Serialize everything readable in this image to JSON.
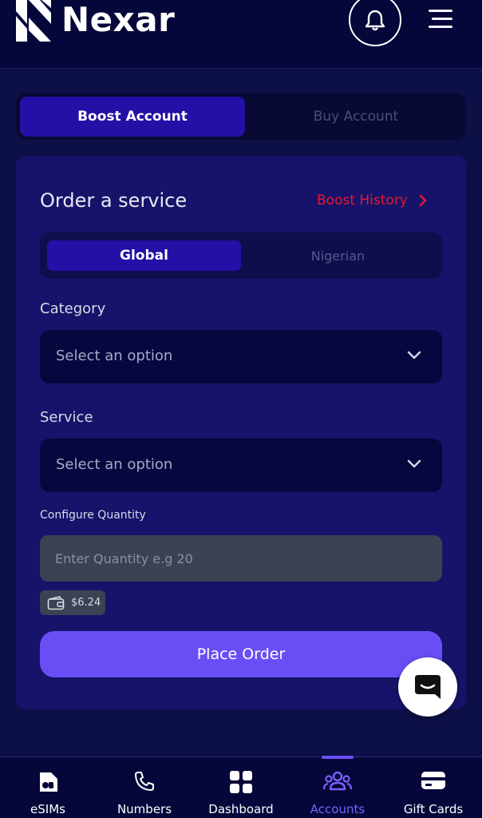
{
  "app": {
    "brand_name": "Nexar"
  },
  "account_tabs": [
    {
      "label": "Boost Account",
      "active": true
    },
    {
      "label": "Buy Account",
      "active": false
    }
  ],
  "order": {
    "title": "Order a service",
    "history_link": "Boost History",
    "region_tabs": [
      {
        "label": "Global",
        "active": true
      },
      {
        "label": "Nigerian",
        "active": false
      }
    ],
    "category": {
      "label": "Category",
      "placeholder": "Select an option"
    },
    "service": {
      "label": "Service",
      "placeholder": "Select an option"
    },
    "quantity": {
      "label": "Configure Quantity",
      "placeholder": "Enter Quantity e.g 20",
      "value": ""
    },
    "balance": "$6.24",
    "submit_label": "Place Order"
  },
  "bottom_nav": [
    {
      "label": "eSIMs",
      "icon": "esim-icon",
      "active": false
    },
    {
      "label": "Numbers",
      "icon": "phone-icon",
      "active": false
    },
    {
      "label": "Dashboard",
      "icon": "dashboard-icon",
      "active": false
    },
    {
      "label": "Accounts",
      "icon": "users-icon",
      "active": true
    },
    {
      "label": "Gift Cards",
      "icon": "gift-card-icon",
      "active": false
    }
  ],
  "colors": {
    "background": "#0d0f47",
    "accent": "#6a4ef5",
    "active_tab": "#2410a6",
    "history_link": "#e8192c"
  }
}
